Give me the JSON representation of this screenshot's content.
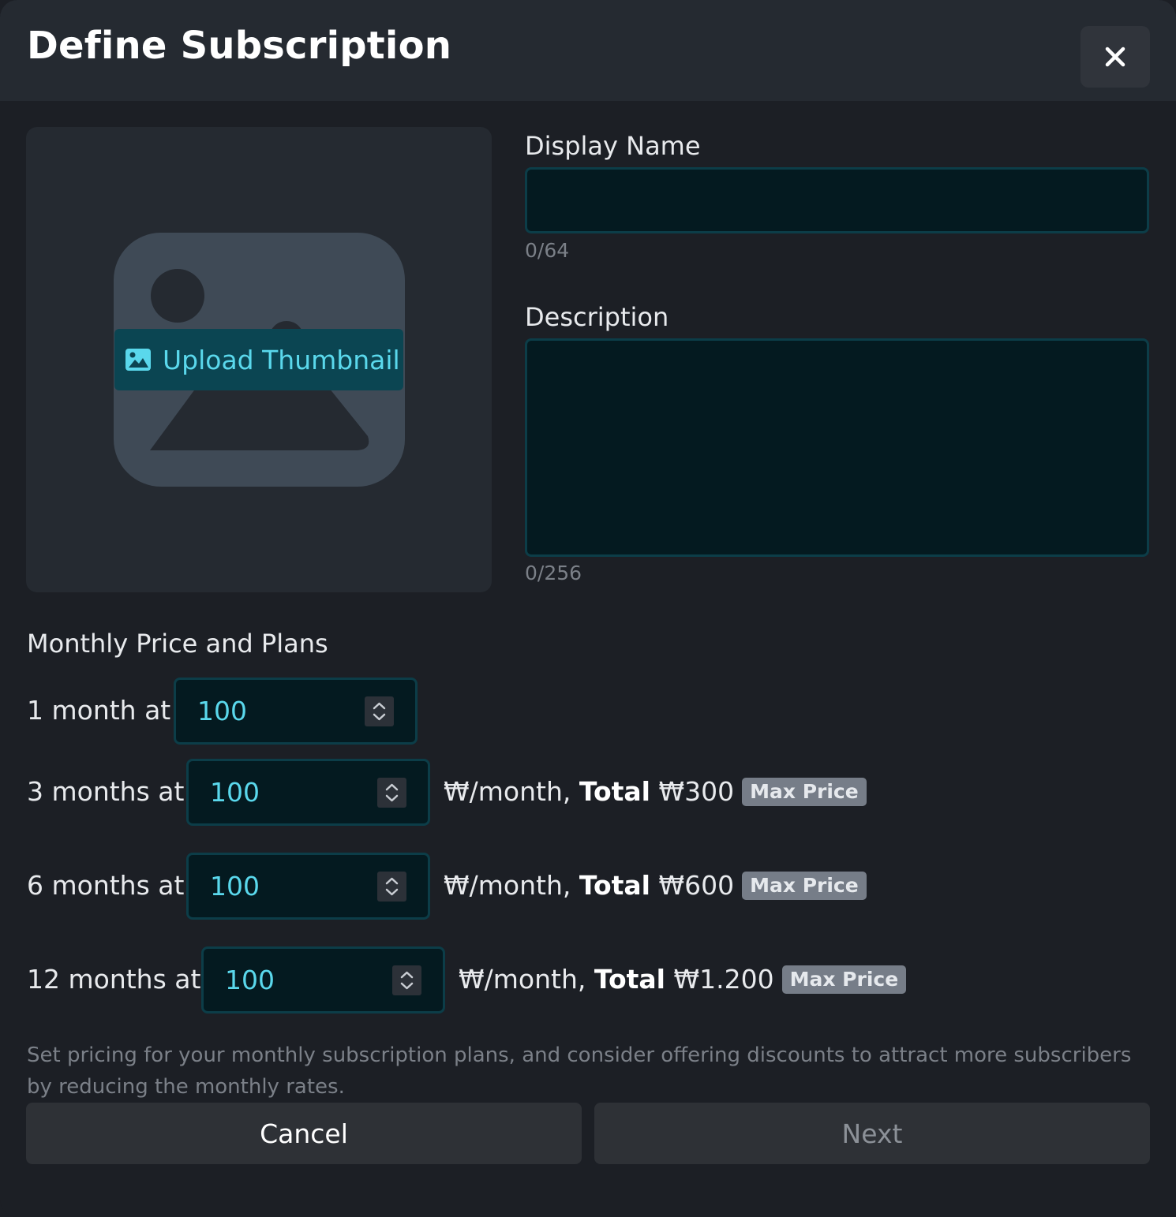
{
  "dialog": {
    "title": "Define Subscription",
    "close_icon": "close-icon"
  },
  "thumbnail": {
    "placeholder_icon": "image-placeholder-icon",
    "upload_icon": "image-icon",
    "upload_label": "Upload Thumbnail"
  },
  "display_name": {
    "label": "Display Name",
    "value": "",
    "counter": "0/64"
  },
  "description": {
    "label": "Description",
    "value": "",
    "counter": "0/256"
  },
  "pricing": {
    "section_label": "Monthly Price and Plans",
    "plans": [
      {
        "label": "1 month at",
        "value": "100"
      },
      {
        "label": "3 months at",
        "value": "100",
        "per_month": "₩/month,",
        "total_label": "Total",
        "total_value": "₩300",
        "badge": "Max Price"
      },
      {
        "label": "6 months at",
        "value": "100",
        "per_month": "₩/month,",
        "total_label": "Total",
        "total_value": "₩600",
        "badge": "Max Price"
      },
      {
        "label": "12 months at",
        "value": "100",
        "per_month": "₩/month,",
        "total_label": "Total",
        "total_value": "₩1.200",
        "badge": "Max Price"
      }
    ],
    "help_text": "Set pricing for your monthly subscription plans, and consider offering discounts to attract more subscribers by reducing the monthly rates."
  },
  "footer": {
    "cancel_label": "Cancel",
    "next_label": "Next"
  },
  "colors": {
    "accent": "#5ad8ec",
    "background": "#1c1f25",
    "header": "#252a31",
    "input_bg": "#041a20",
    "input_border": "#0c3d48",
    "badge": "#767d88"
  }
}
